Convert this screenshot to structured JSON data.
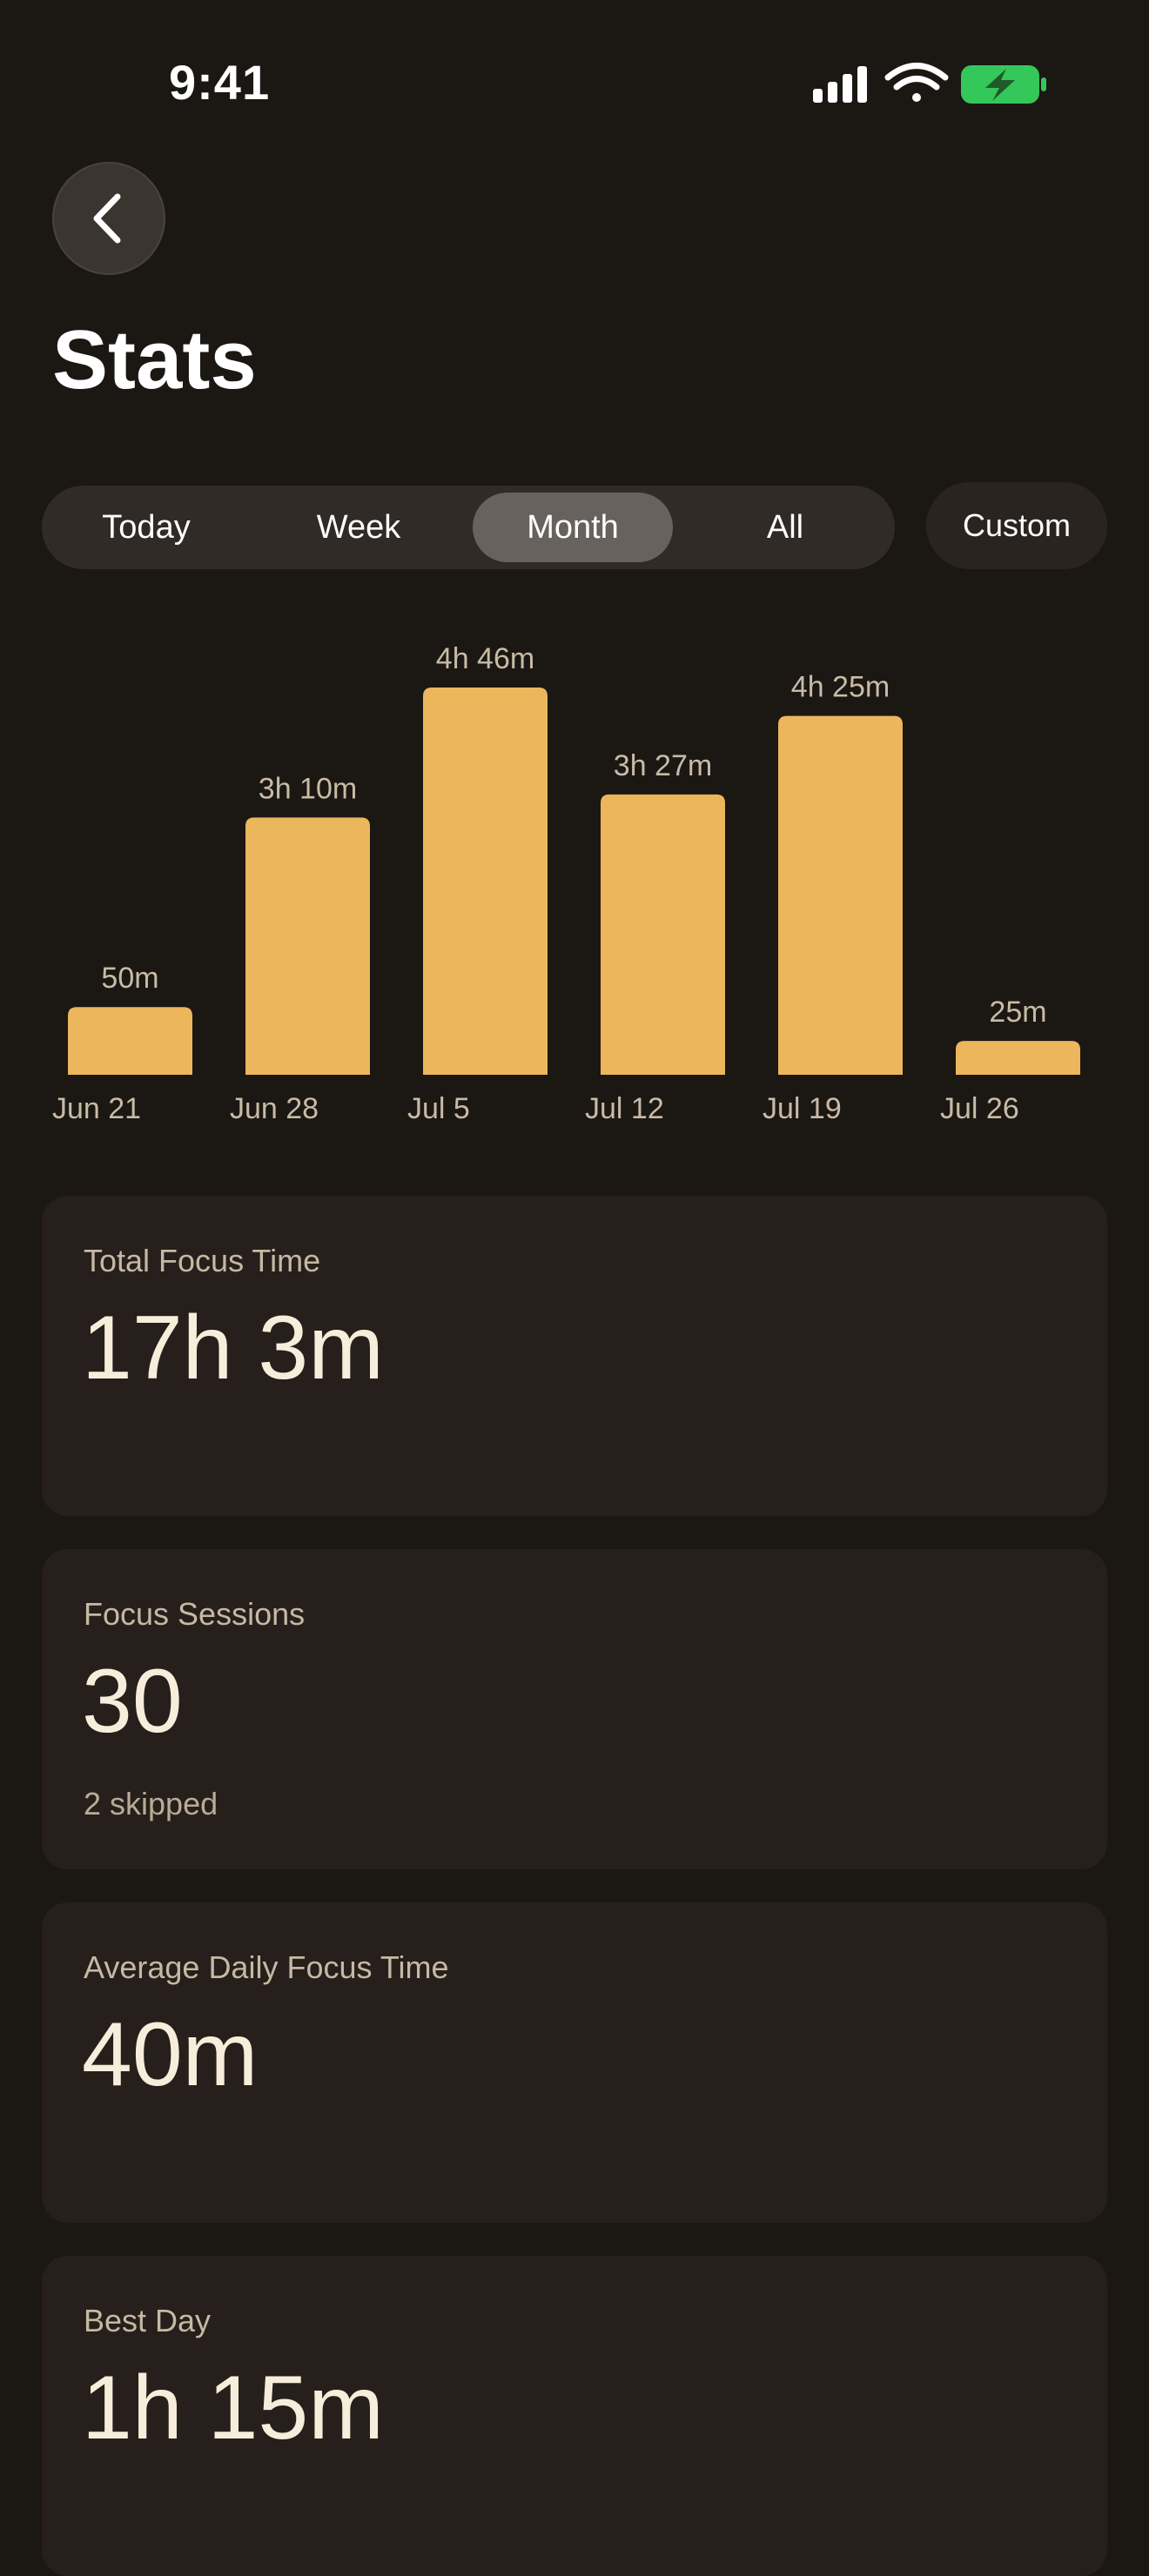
{
  "status_bar": {
    "time": "9:41",
    "icons": [
      "cellular-signal-icon",
      "wifi-icon",
      "battery-charging-icon"
    ],
    "battery_color": "#34c759"
  },
  "header": {
    "back_icon": "chevron-left-icon",
    "title": "Stats"
  },
  "range_tabs": {
    "items": [
      {
        "label": "Today",
        "active": false
      },
      {
        "label": "Week",
        "active": false
      },
      {
        "label": "Month",
        "active": true
      },
      {
        "label": "All",
        "active": false
      }
    ],
    "custom_label": "Custom"
  },
  "colors": {
    "background": "#1b1713",
    "bar": "#ecb65c",
    "card": "#261f1b",
    "accent_text": "#f6eedb"
  },
  "chart_data": {
    "type": "bar",
    "categories": [
      "Jun 21",
      "Jun 28",
      "Jul 5",
      "Jul 12",
      "Jul 19",
      "Jul 26"
    ],
    "values": [
      50,
      190,
      286,
      207,
      265,
      25
    ],
    "value_labels": [
      "50m",
      "3h 10m",
      "4h 46m",
      "3h 27m",
      "4h 25m",
      "25m"
    ],
    "unit": "minutes",
    "title": "",
    "xlabel": "",
    "ylabel": "",
    "grid": false
  },
  "cards": [
    {
      "label": "Total Focus Time",
      "value": "17h 3m",
      "sub": ""
    },
    {
      "label": "Focus Sessions",
      "value": "30",
      "sub": "2 skipped"
    },
    {
      "label": "Average Daily Focus Time",
      "value": "40m",
      "sub": ""
    },
    {
      "label": "Best Day",
      "value": "1h 15m",
      "sub": ""
    }
  ]
}
